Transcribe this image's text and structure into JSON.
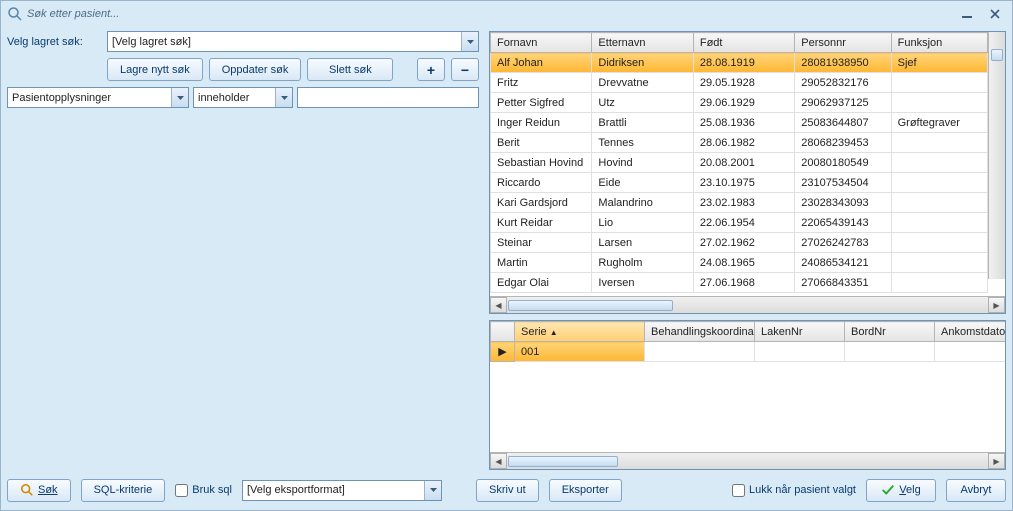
{
  "window": {
    "title": "Søk etter pasient..."
  },
  "savedSearch": {
    "label": "Velg lagret søk:",
    "combo": "[Velg lagret søk]",
    "saveNew": "Lagre nytt søk",
    "update": "Oppdater søk",
    "delete": "Slett søk"
  },
  "criteria": {
    "field": "Pasientopplysninger",
    "operator": "inneholder",
    "value": ""
  },
  "mainGrid": {
    "headers": [
      "Fornavn",
      "Etternavn",
      "Født",
      "Personnr",
      "Funksjon"
    ],
    "rows": [
      {
        "fornavn": "Alf Johan",
        "etternavn": "Didriksen",
        "fodt": "28.08.1919",
        "personnr": "28081938950",
        "funksjon": "Sjef",
        "selected": true
      },
      {
        "fornavn": "Fritz",
        "etternavn": "Drevvatne",
        "fodt": "29.05.1928",
        "personnr": "29052832176",
        "funksjon": ""
      },
      {
        "fornavn": "Petter Sigfred",
        "etternavn": "Utz",
        "fodt": "29.06.1929",
        "personnr": "29062937125",
        "funksjon": ""
      },
      {
        "fornavn": "Inger Reidun",
        "etternavn": "Brattli",
        "fodt": "25.08.1936",
        "personnr": "25083644807",
        "funksjon": "Grøftegraver"
      },
      {
        "fornavn": "Berit",
        "etternavn": "Tennes",
        "fodt": "28.06.1982",
        "personnr": "28068239453",
        "funksjon": ""
      },
      {
        "fornavn": "Sebastian Hovind",
        "etternavn": "Hovind",
        "fodt": "20.08.2001",
        "personnr": "20080180549",
        "funksjon": ""
      },
      {
        "fornavn": "Riccardo",
        "etternavn": "Eide",
        "fodt": "23.10.1975",
        "personnr": "23107534504",
        "funksjon": ""
      },
      {
        "fornavn": "Kari Gardsjord",
        "etternavn": "Malandrino",
        "fodt": "23.02.1983",
        "personnr": "23028343093",
        "funksjon": ""
      },
      {
        "fornavn": "Kurt Reidar",
        "etternavn": "Lio",
        "fodt": "22.06.1954",
        "personnr": "22065439143",
        "funksjon": ""
      },
      {
        "fornavn": "Steinar",
        "etternavn": "Larsen",
        "fodt": "27.02.1962",
        "personnr": "27026242783",
        "funksjon": ""
      },
      {
        "fornavn": "Martin",
        "etternavn": "Rugholm",
        "fodt": "24.08.1965",
        "personnr": "24086534121",
        "funksjon": ""
      },
      {
        "fornavn": "Edgar Olai",
        "etternavn": "Iversen",
        "fodt": "27.06.1968",
        "personnr": "27066843351",
        "funksjon": ""
      }
    ]
  },
  "subGrid": {
    "headers": [
      "Serie",
      "Behandlingskoordinator",
      "LakenNr",
      "BordNr",
      "Ankomstdato"
    ],
    "rows": [
      {
        "serie": "001",
        "behandlingskoordin": "",
        "lakenNr": "",
        "bordNr": "",
        "ankomstdato": ""
      }
    ]
  },
  "footer": {
    "search": "Søk",
    "sqlKriterie": "SQL-kriterie",
    "brukSql": "Bruk sql",
    "exportFormat": "[Velg eksportformat]",
    "skrivUt": "Skriv ut",
    "eksporter": "Eksporter",
    "lukkNaar": "Lukk når pasient valgt",
    "velg": "Velg",
    "avbryt": "Avbryt"
  }
}
